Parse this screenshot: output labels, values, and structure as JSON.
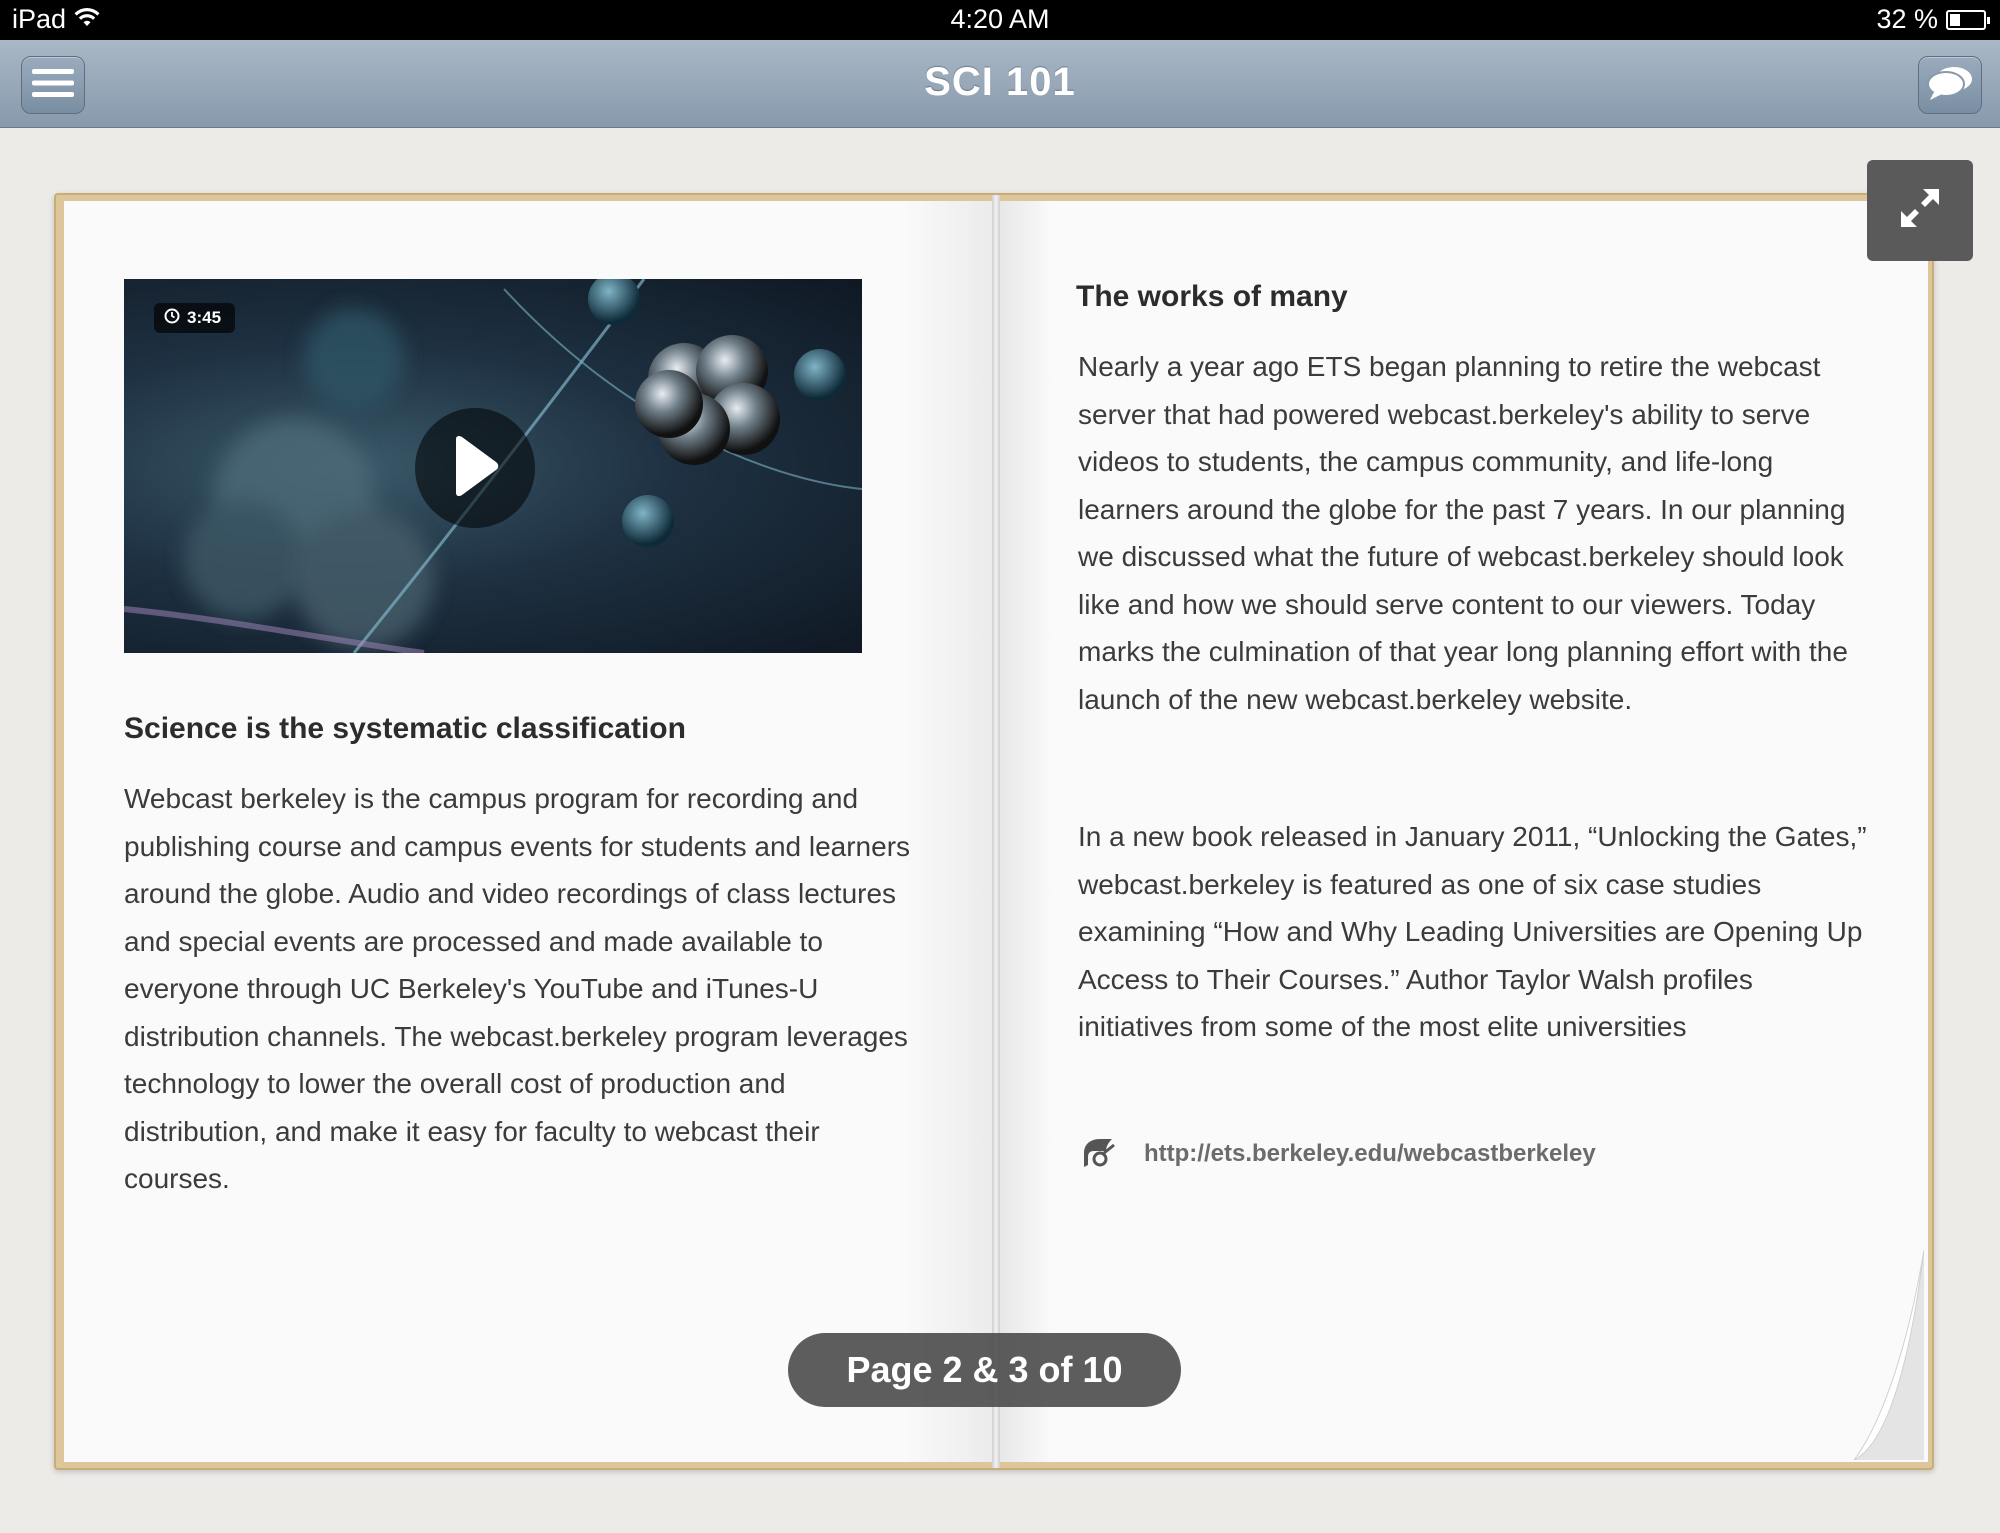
{
  "status_bar": {
    "device": "iPad",
    "time": "4:20 AM",
    "battery": "32 %",
    "battery_level": 0.32
  },
  "nav": {
    "title": "SCI 101",
    "menu_icon": "hamburger-icon",
    "chat_icon": "speech-bubbles-icon"
  },
  "left_page": {
    "video": {
      "duration": "3:45",
      "play_icon": "play-icon",
      "clock_icon": "clock-icon"
    },
    "heading": "Science is the systematic classification",
    "body": "Webcast berkeley is the campus program for recording and publishing course and campus events for students and learners around the globe. Audio and video recordings of class lectures and special events are pro­cessed and made available to everyone through UC Berkeley's YouTube and iTunes-U distribution channels. The webcast.berkeley program leverages technology to lower the overall cost of production and distribution, and make it easy for faculty to webcast their courses."
  },
  "right_page": {
    "heading": "The works of many",
    "paragraph1": "Nearly a year ago ETS began planning to retire the webcast server that had powered webcast.berkeley's ability to serve videos to students, the campus commu­nity, and life-long learners around the globe for the past 7 years. In our planning we discussed what the future of webcast.berkeley should look like and how we should serve content to our viewers. Today marks the culmination of that year long planning effort with the launch of the new webcast.berkeley website.",
    "paragraph2": "In a new book released in January 2011, “Unlocking the Gates,” webcast.berkeley is featured as one of six case studies examining “How and Why Leading Universities are Opening Up Access to Their Courses.” Author Taylor Walsh profiles initiatives from some of the most elite universities",
    "link": "http://ets.berkeley.edu/webcastberkeley",
    "link_icon": "link-chain-icon"
  },
  "page_indicator": "Page 2 & 3 of 10",
  "expand_icon": "expand-arrows-icon"
}
